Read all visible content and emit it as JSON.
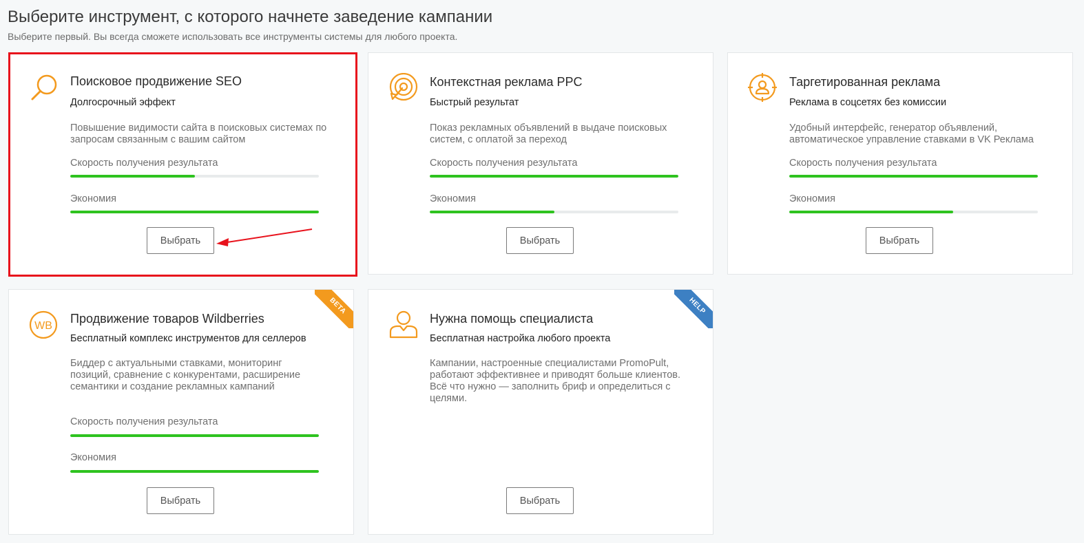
{
  "header": {
    "title": "Выберите инструмент, с которого начнете заведение кампании",
    "subtitle": "Выберите первый. Вы всегда сможете использовать все инструменты системы для любого проекта."
  },
  "colors": {
    "accent": "#f39a1e",
    "progress": "#2ec31f",
    "highlight_border": "#e8121c",
    "beta_ribbon": "#f39a1e",
    "help_ribbon": "#3d80c3"
  },
  "cards": [
    {
      "icon": "magnifier-icon",
      "title": "Поисковое продвижение SEO",
      "tagline": "Долгосрочный эффект",
      "description": "Повышение видимости сайта в поисковых системах по запросам связанным с вашим сайтом",
      "speed_label": "Скорость получения результата",
      "speed_value": 0.5,
      "economy_label": "Экономия",
      "economy_value": 1.0,
      "button": "Выбрать"
    },
    {
      "icon": "target-cursor-icon",
      "title": "Контекстная реклама PPC",
      "tagline": "Быстрый результат",
      "description": "Показ рекламных объявлений в выдаче поисковых систем, с оплатой за переход",
      "speed_label": "Скорость получения результата",
      "speed_value": 1.0,
      "economy_label": "Экономия",
      "economy_value": 0.5,
      "button": "Выбрать"
    },
    {
      "icon": "crosshair-person-icon",
      "title": "Таргетированная реклама",
      "tagline": "Реклама в соцсетях без комиссии",
      "description": "Удобный интерфейс, генератор объявлений, автоматическое управление ставками в VK Реклама",
      "speed_label": "Скорость получения результата",
      "speed_value": 1.0,
      "economy_label": "Экономия",
      "economy_value": 0.66,
      "button": "Выбрать"
    },
    {
      "icon": "wb-logo-icon",
      "title": "Продвижение товаров Wildberries",
      "tagline": "Бесплатный комплекс инструментов для селлеров",
      "description": "Биддер с актуальными ставками, мониторинг позиций, сравнение с конкурентами, расширение семантики и создание рекламных кампаний",
      "speed_label": "Скорость получения результата",
      "speed_value": 1.0,
      "economy_label": "Экономия",
      "economy_value": 1.0,
      "button": "Выбрать",
      "ribbon": "BETA"
    },
    {
      "icon": "person-icon",
      "title": "Нужна помощь специалиста",
      "tagline": "Бесплатная настройка любого проекта",
      "description": "Кампании, настроенные специалистами PromoPult, работают эффективнее и приводят больше клиентов. Всё что нужно — заполнить бриф и определиться с целями.",
      "button": "Выбрать",
      "ribbon": "HELP"
    }
  ]
}
